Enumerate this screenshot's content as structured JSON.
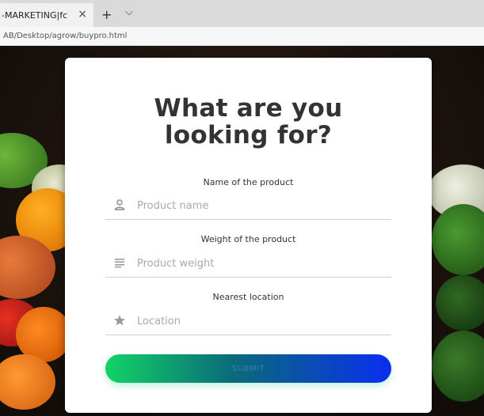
{
  "browser": {
    "tab_title": "-MARKETING|fc",
    "tab_close": "×",
    "new_tab": "+",
    "tab_menu": "⌵",
    "address": "AB/Desktop/agrow/buypro.html"
  },
  "form": {
    "title_line1": "What are you",
    "title_line2": "looking for?",
    "fields": [
      {
        "label": "Name of the product",
        "placeholder": "Product name",
        "icon": "person-icon"
      },
      {
        "label": "Weight of the product",
        "placeholder": "Product weight",
        "icon": "lines-icon"
      },
      {
        "label": "Nearest location",
        "placeholder": "Location",
        "icon": "star-icon"
      }
    ],
    "submit_label": "SUBMIT"
  },
  "colors": {
    "submit_start": "#12d366",
    "submit_end": "#0a2ef0",
    "title": "#333333"
  }
}
